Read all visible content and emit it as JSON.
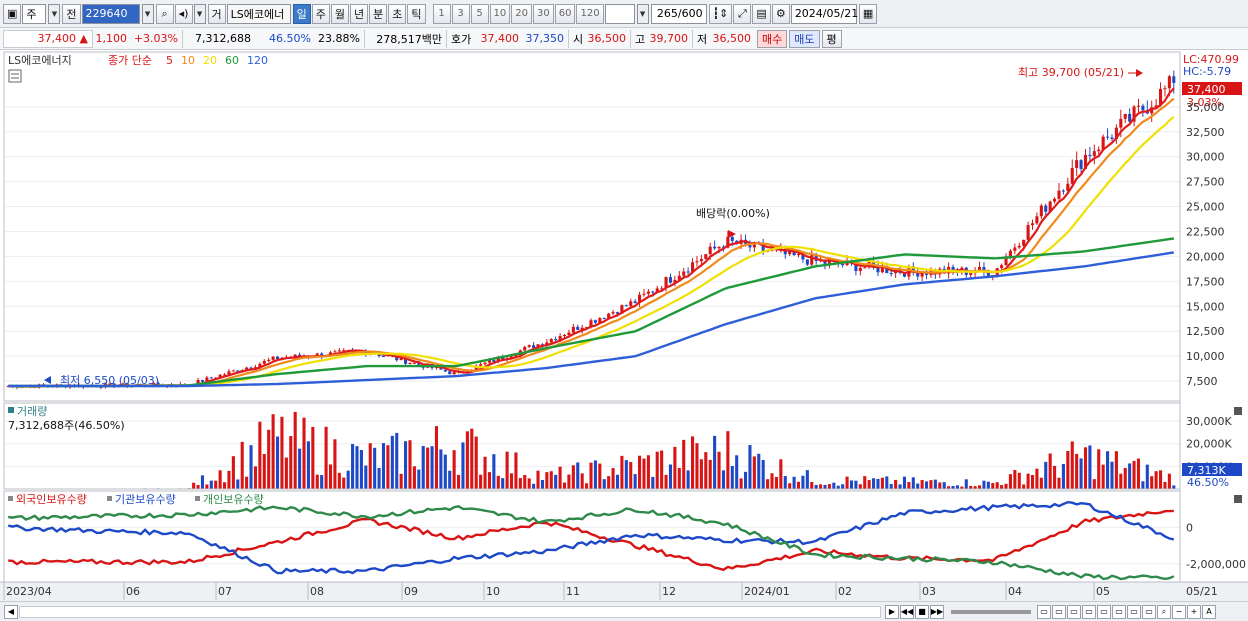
{
  "toolbar": {
    "market": "주",
    "prev_label": "전",
    "code": "229640",
    "trade_label": "거",
    "stock_name": "LS에코에너",
    "periods": [
      {
        "label": "일",
        "active": true
      },
      {
        "label": "주",
        "active": false
      },
      {
        "label": "월",
        "active": false
      },
      {
        "label": "년",
        "active": false
      },
      {
        "label": "분",
        "active": false
      },
      {
        "label": "초",
        "active": false
      },
      {
        "label": "틱",
        "active": false
      }
    ],
    "intervals": [
      "1",
      "3",
      "5",
      "10",
      "20",
      "30",
      "60",
      "120"
    ],
    "count": "265",
    "count_max": "/600",
    "date": "2024/05/21"
  },
  "quote": {
    "price": "37,400",
    "arrow": "▲",
    "change": "1,100",
    "change_pct": "+3.03%",
    "volume": "7,312,688",
    "volume_ratio": "46.50%",
    "turnover": "23.88%",
    "amount": "278,517백만",
    "bid_label": "호가",
    "ask": "37,400",
    "bid": "37,350",
    "open_label": "시",
    "open": "36,500",
    "high_label": "고",
    "high": "39,700",
    "low_label": "저",
    "low": "36,500",
    "buy_label": "매수",
    "sell_label": "매도",
    "avg_label": "평"
  },
  "price_panel": {
    "stock_name": "LS에코에너지",
    "ma_title": "종가 단순",
    "ma_periods": [
      {
        "label": "5",
        "color": "#e01b1b"
      },
      {
        "label": "10",
        "color": "#f08a1a"
      },
      {
        "label": "20",
        "color": "#f0e000"
      },
      {
        "label": "60",
        "color": "#1f9a3a"
      },
      {
        "label": "120",
        "color": "#2f5fd8"
      }
    ],
    "lc": "LC:470.99",
    "hc": "HC:-5.79",
    "max_note": "최고 39,700 (05/21)",
    "min_note": "최저 6,550 (05/03)",
    "dividend_note": "배당락(0.00%)",
    "current_price_tag": "37,400",
    "current_pct_tag": "3.03%",
    "y_labels": [
      "35,000",
      "32,500",
      "30,000",
      "27,500",
      "25,000",
      "22,500",
      "20,000",
      "17,500",
      "15,000",
      "12,500",
      "10,000",
      "7,500"
    ]
  },
  "volume_panel": {
    "title": "거래량",
    "value": "7,312,688주(46.50%)",
    "y_labels": [
      "30,000K",
      "20,000K",
      "10,000K"
    ],
    "tag_value": "7,313K",
    "tag_pct": "46.50%"
  },
  "holding_panel": {
    "series": [
      {
        "label": "외국인보유수량",
        "color": "#d81414"
      },
      {
        "label": "기관보유수량",
        "color": "#1d49c7"
      },
      {
        "label": "개인보유수량",
        "color": "#2f8a4a"
      }
    ],
    "y_labels": [
      "0",
      "-2,000,000"
    ]
  },
  "x_axis": {
    "labels": [
      "2023/04",
      "06",
      "07",
      "08",
      "09",
      "10",
      "11",
      "12",
      "2024/01",
      "02",
      "03",
      "04",
      "05"
    ],
    "right_label": "05/21"
  },
  "colors": {
    "up": "#d81414",
    "down": "#1d49c7",
    "accent": "#3266c4"
  },
  "chart_data": {
    "type": "line",
    "x": [
      "2023/04",
      "06",
      "07",
      "08",
      "09",
      "10",
      "11",
      "12",
      "2024/01",
      "02",
      "03",
      "04",
      "05",
      "05/21"
    ],
    "series": [
      {
        "values": [
          7000,
          7050,
          7100,
          9800,
          10500,
          8200,
          11500,
          15500,
          21500,
          19500,
          18500,
          18500,
          30000,
          37400
        ]
      },
      {
        "name": "60",
        "values": [
          7000,
          7000,
          7050,
          8200,
          9000,
          9000,
          10800,
          12500,
          16800,
          19000,
          20200,
          19800,
          20500,
          21800
        ]
      },
      {
        "name": "120",
        "values": [
          7000,
          7000,
          7000,
          7200,
          7600,
          8000,
          8800,
          10000,
          13200,
          15800,
          17200,
          18000,
          19000,
          20400
        ]
      }
    ],
    "ylim": [
      5500,
      40500
    ],
    "volume_k": [
      200,
      200,
      300,
      34000,
      20000,
      30000,
      8000,
      16000,
      26000,
      6000,
      5000,
      4000,
      22000,
      7313
    ],
    "holding": {
      "foreign": [
        -1900000,
        -1900000,
        -1900000,
        -800000,
        400000,
        -600000,
        300000,
        -1000000,
        -2300000,
        -1300000,
        -1700000,
        -1800000,
        300000,
        1000000
      ],
      "institution": [
        0,
        -200000,
        -300000,
        -2400000,
        -2400000,
        -1700000,
        -1300000,
        -400000,
        -700000,
        -800000,
        800000,
        1100000,
        1300000,
        -600000
      ],
      "individual": [
        500000,
        600000,
        700000,
        1100000,
        600000,
        1100000,
        300000,
        1000000,
        200000,
        -1500000,
        -1700000,
        -1900000,
        -2700000,
        -2800000
      ]
    }
  }
}
